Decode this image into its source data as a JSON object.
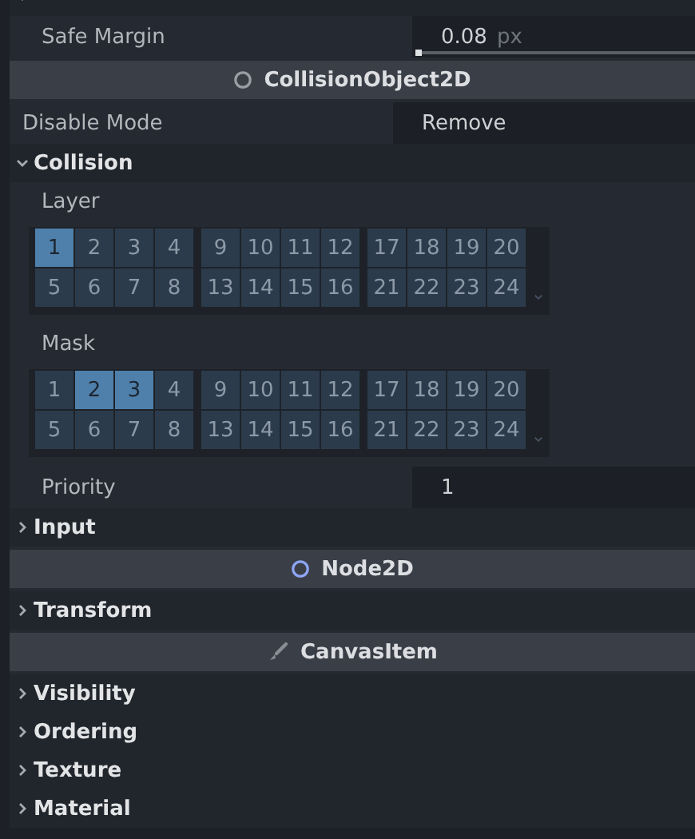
{
  "rows": [
    {
      "kind": "section",
      "expanded": true,
      "children": [
        {
          "kind": "property",
          "label": "Safe Margin",
          "value": "0.08",
          "unit": "px",
          "level": 0
        }
      ]
    },
    {
      "kind": "category",
      "label": "CollisionObject2D"
    },
    {
      "kind": "property",
      "label": "Disable Mode",
      "value": "Remove"
    },
    {
      "kind": "section",
      "label": "Collision",
      "expanded": true,
      "children": [
        {
          "kind": "layers",
          "label": "Layer",
          "cells": [
            {
              "label": "1",
              "selected": true
            },
            {
              "label": "2",
              "selected": false
            },
            {
              "label": "3",
              "selected": false
            },
            {
              "label": "4",
              "selected": false
            },
            {
              "label": "9",
              "selected": false
            },
            {
              "label": "10",
              "selected": false
            },
            {
              "label": "11",
              "selected": false
            },
            {
              "label": "12",
              "selected": false
            },
            {
              "label": "17",
              "selected": false
            },
            {
              "label": "18",
              "selected": false
            },
            {
              "label": "19",
              "selected": false
            },
            {
              "label": "20",
              "selected": false
            },
            {
              "label": "5",
              "selected": false
            },
            {
              "label": "6",
              "selected": false
            },
            {
              "label": "7",
              "selected": false
            },
            {
              "label": "8",
              "selected": false
            },
            {
              "label": "13",
              "selected": false
            },
            {
              "label": "14",
              "selected": false
            },
            {
              "label": "15",
              "selected": false
            },
            {
              "label": "16",
              "selected": false
            },
            {
              "label": "21",
              "selected": false
            },
            {
              "label": "22",
              "selected": false
            },
            {
              "label": "23",
              "selected": false
            },
            {
              "label": "24",
              "selected": false
            }
          ]
        },
        {
          "kind": "layers",
          "label": "Mask",
          "cells": [
            {
              "label": "1",
              "selected": false
            },
            {
              "label": "2",
              "selected": true
            },
            {
              "label": "3",
              "selected": true
            },
            {
              "label": "4",
              "selected": false
            },
            {
              "label": "9",
              "selected": false
            },
            {
              "label": "10",
              "selected": false
            },
            {
              "label": "11",
              "selected": false
            },
            {
              "label": "12",
              "selected": false
            },
            {
              "label": "17",
              "selected": false
            },
            {
              "label": "18",
              "selected": false
            },
            {
              "label": "19",
              "selected": false
            },
            {
              "label": "20",
              "selected": false
            },
            {
              "label": "5",
              "selected": false
            },
            {
              "label": "6",
              "selected": false
            },
            {
              "label": "7",
              "selected": false
            },
            {
              "label": "8",
              "selected": false
            },
            {
              "label": "13",
              "selected": false
            },
            {
              "label": "14",
              "selected": false
            },
            {
              "label": "15",
              "selected": false
            },
            {
              "label": "16",
              "selected": false
            },
            {
              "label": "21",
              "selected": false
            },
            {
              "label": "22",
              "selected": false
            },
            {
              "label": "23",
              "selected": false
            },
            {
              "label": "24",
              "selected": false
            }
          ]
        },
        {
          "kind": "property",
          "label": "Priority",
          "value": "1"
        }
      ]
    },
    {
      "kind": "section",
      "label": "Input",
      "expanded": false
    },
    {
      "kind": "category",
      "label": "Node2D"
    },
    {
      "kind": "section",
      "label": "Transform",
      "expanded": false
    },
    {
      "kind": "category",
      "label": "CanvasItem"
    },
    {
      "kind": "section",
      "label": "Visibility",
      "expanded": false
    },
    {
      "kind": "section",
      "label": "Ordering",
      "expanded": false
    },
    {
      "kind": "section",
      "label": "Texture",
      "expanded": false
    },
    {
      "kind": "section",
      "label": "Material",
      "expanded": false
    }
  ]
}
